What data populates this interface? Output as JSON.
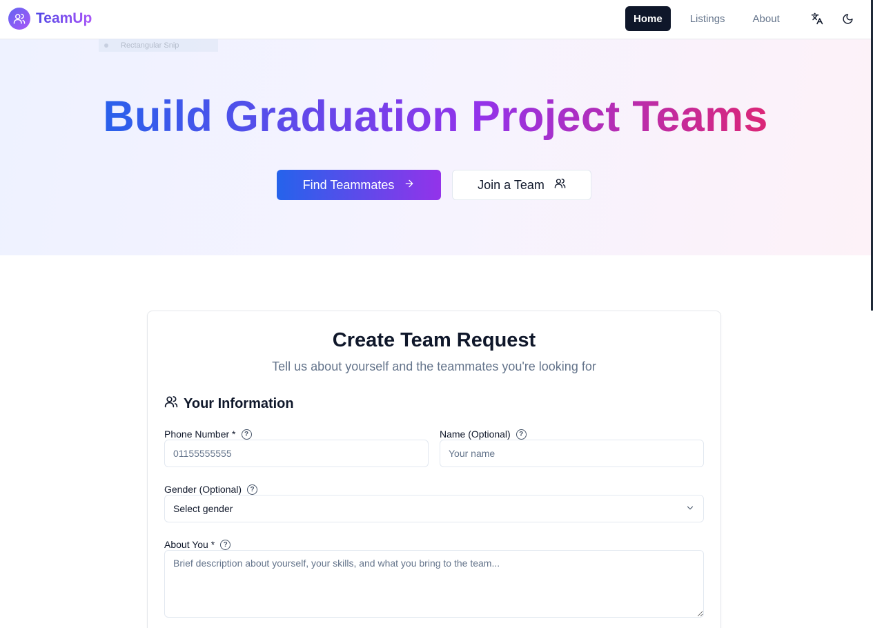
{
  "brand": {
    "name": "TeamUp",
    "logo_icon": "users-icon"
  },
  "nav": {
    "items": [
      {
        "label": "Home",
        "active": true
      },
      {
        "label": "Listings",
        "active": false
      },
      {
        "label": "About",
        "active": false
      }
    ],
    "language_icon": "translate-icon",
    "theme_icon": "moon-icon"
  },
  "snip_overlay": {
    "text": "Rectangular Snip"
  },
  "hero": {
    "title": "Build Graduation Project Teams",
    "primary_button": "Find Teammates",
    "secondary_button": "Join a Team"
  },
  "form": {
    "title": "Create Team Request",
    "subtitle": "Tell us about yourself and the teammates you're looking for",
    "section_title": "Your Information",
    "phone": {
      "label": "Phone Number *",
      "placeholder": "01155555555"
    },
    "name": {
      "label": "Name (Optional)",
      "placeholder": "Your name"
    },
    "gender": {
      "label": "Gender (Optional)",
      "value": "Select gender"
    },
    "about": {
      "label": "About You *",
      "placeholder": "Brief description about yourself, your skills, and what you bring to the team..."
    }
  },
  "colors": {
    "accent_blue": "#2563eb",
    "accent_purple": "#9333ea",
    "accent_pink": "#db2777",
    "nav_active_bg": "#0f172a"
  }
}
